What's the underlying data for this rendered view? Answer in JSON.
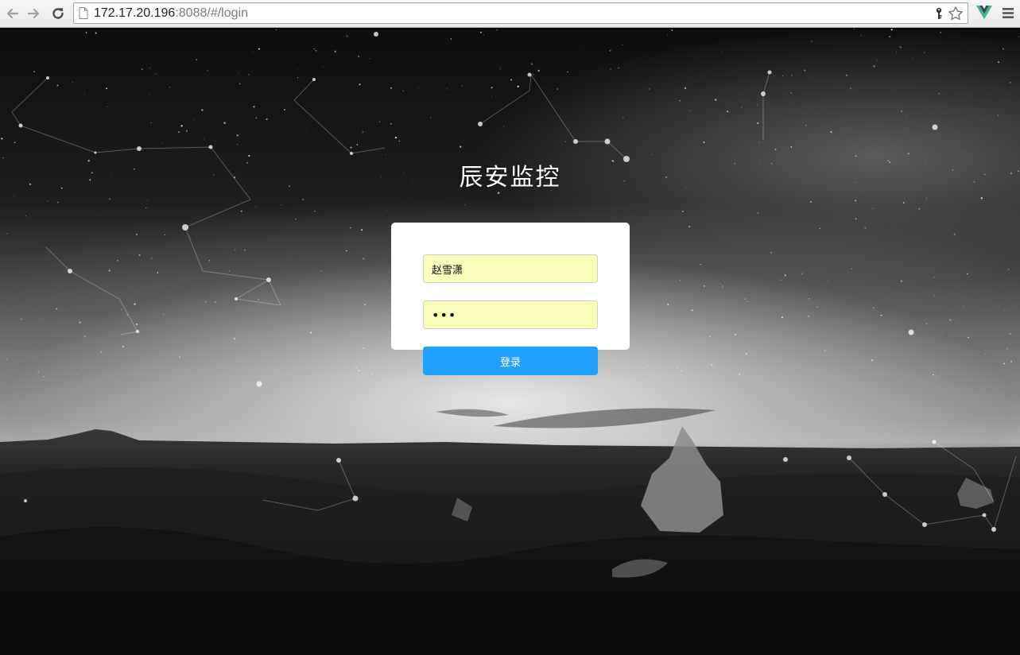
{
  "browser": {
    "url_host": "172.17.20.196",
    "url_rest": ":8088/#/login"
  },
  "login": {
    "title": "辰安监控",
    "username_value": "赵雪潇",
    "password_value": "•••",
    "submit_label": "登录"
  },
  "colors": {
    "button": "#20a0ff",
    "autofill": "#fbfdbd"
  }
}
